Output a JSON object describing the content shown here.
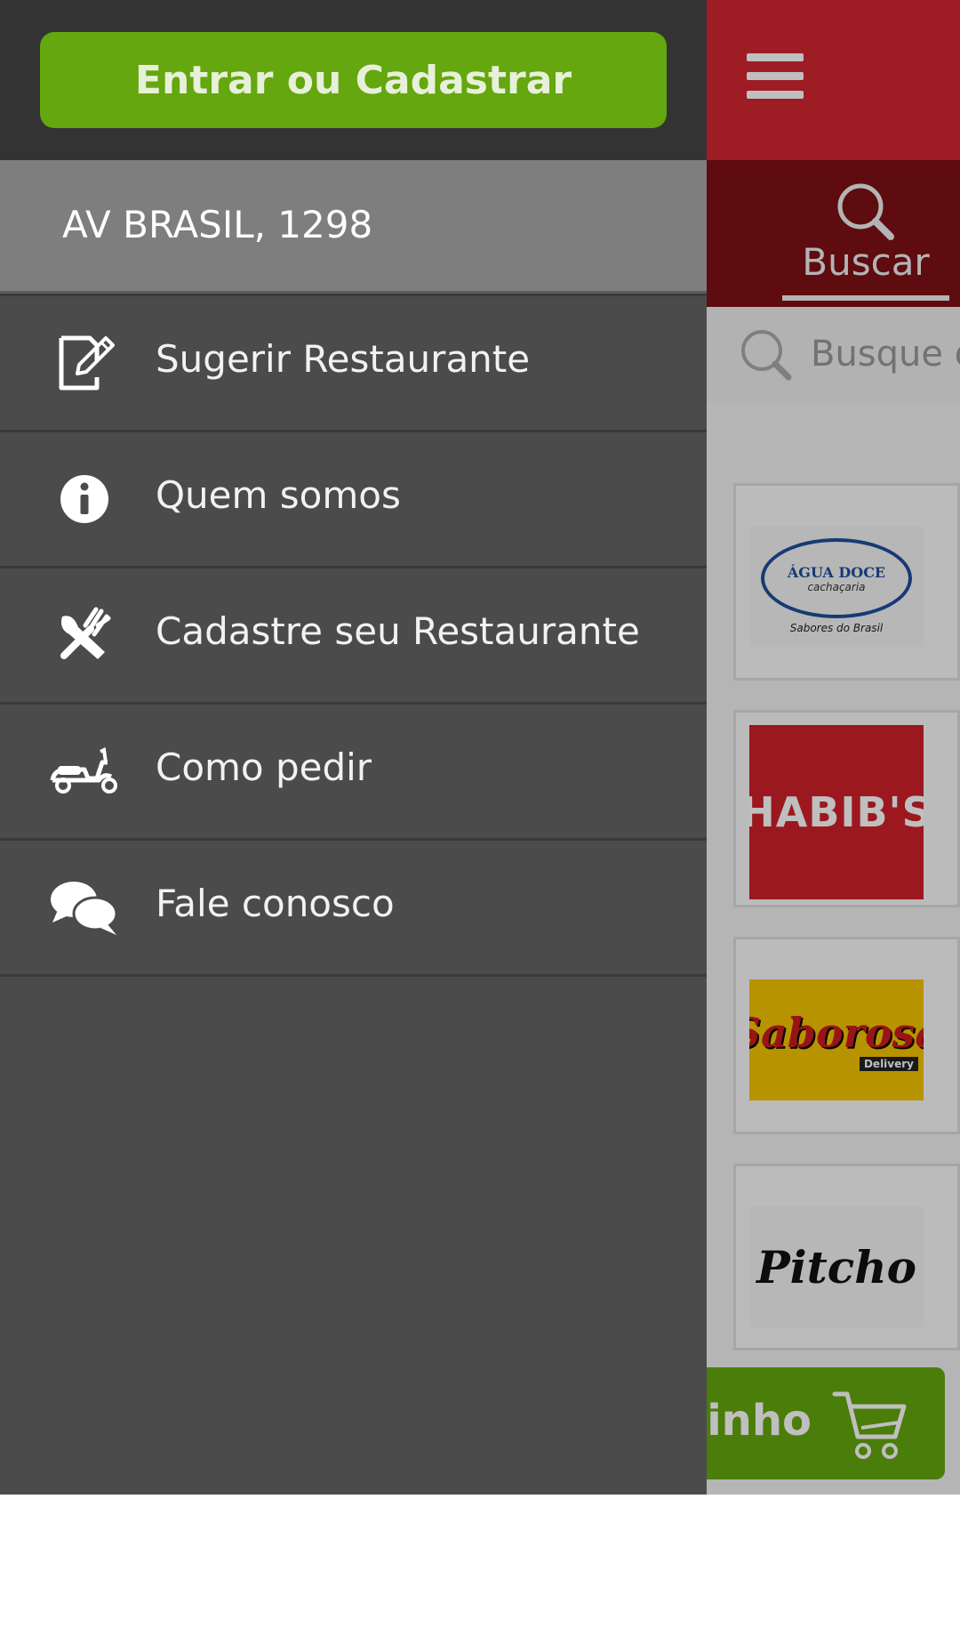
{
  "drawer": {
    "login_button": "Entrar ou Cadastrar",
    "address": "AV BRASIL, 1298",
    "menu_items": [
      {
        "label": "Sugerir Restaurante",
        "icon": "edit-note-icon"
      },
      {
        "label": "Quem somos",
        "icon": "info-icon"
      },
      {
        "label": "Cadastre seu Restaurante",
        "icon": "fork-knife-icon"
      },
      {
        "label": "Como pedir",
        "icon": "scooter-icon"
      },
      {
        "label": "Fale conosco",
        "icon": "chat-bubbles-icon"
      }
    ]
  },
  "app": {
    "colors": {
      "topbar": "#d32630",
      "tabs": "#7e1016",
      "accent_green": "#64a70e",
      "drawer": "#4b4b4b"
    },
    "tab_search_label": "Buscar",
    "search_placeholder": "Busque o",
    "restaurants": [
      {
        "logo_text": "ÁGUA DOCE",
        "logo_subtext": "cachaçaria",
        "logo_tagline": "Sabores do Brasil"
      },
      {
        "logo_text": "HABIB'S"
      },
      {
        "logo_text": "Saborosa",
        "logo_subtext": "Delivery"
      },
      {
        "logo_text": "Pitcho"
      }
    ],
    "cart_label": "rinho"
  }
}
